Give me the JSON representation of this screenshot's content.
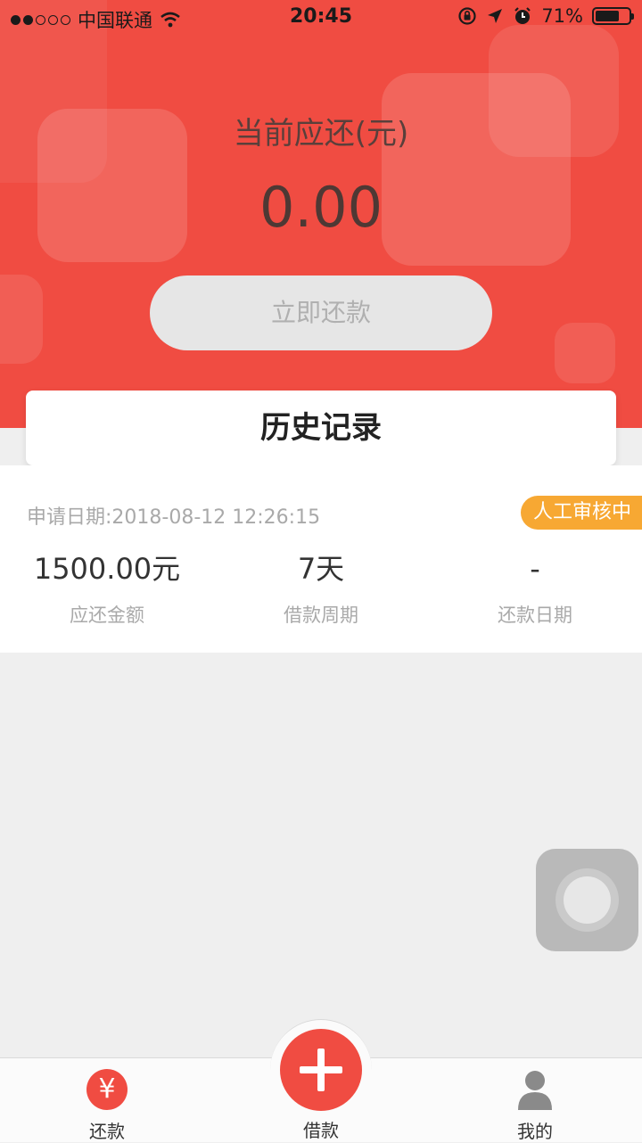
{
  "status_bar": {
    "carrier": "中国联通",
    "time": "20:45",
    "battery": "71%",
    "battery_level": 0.71
  },
  "header": {
    "due_label": "当前应还(元)",
    "due_amount": "0.00",
    "pay_button": "立即还款"
  },
  "history": {
    "title": "历史记录"
  },
  "record": {
    "apply_date": "申请日期:2018-08-12 12:26:15",
    "status": "人工审核中",
    "columns": [
      {
        "value": "1500.00元",
        "label": "应还金额"
      },
      {
        "value": "7天",
        "label": "借款周期"
      },
      {
        "value": "-",
        "label": "还款日期"
      }
    ]
  },
  "tabbar": {
    "tabs": [
      {
        "label": "还款",
        "icon": "yen-icon"
      },
      {
        "label": "借款",
        "icon": "plus-icon"
      },
      {
        "label": "我的",
        "icon": "user-icon"
      }
    ]
  },
  "colors": {
    "brand": "#f04c42",
    "badge": "#f7a833"
  }
}
